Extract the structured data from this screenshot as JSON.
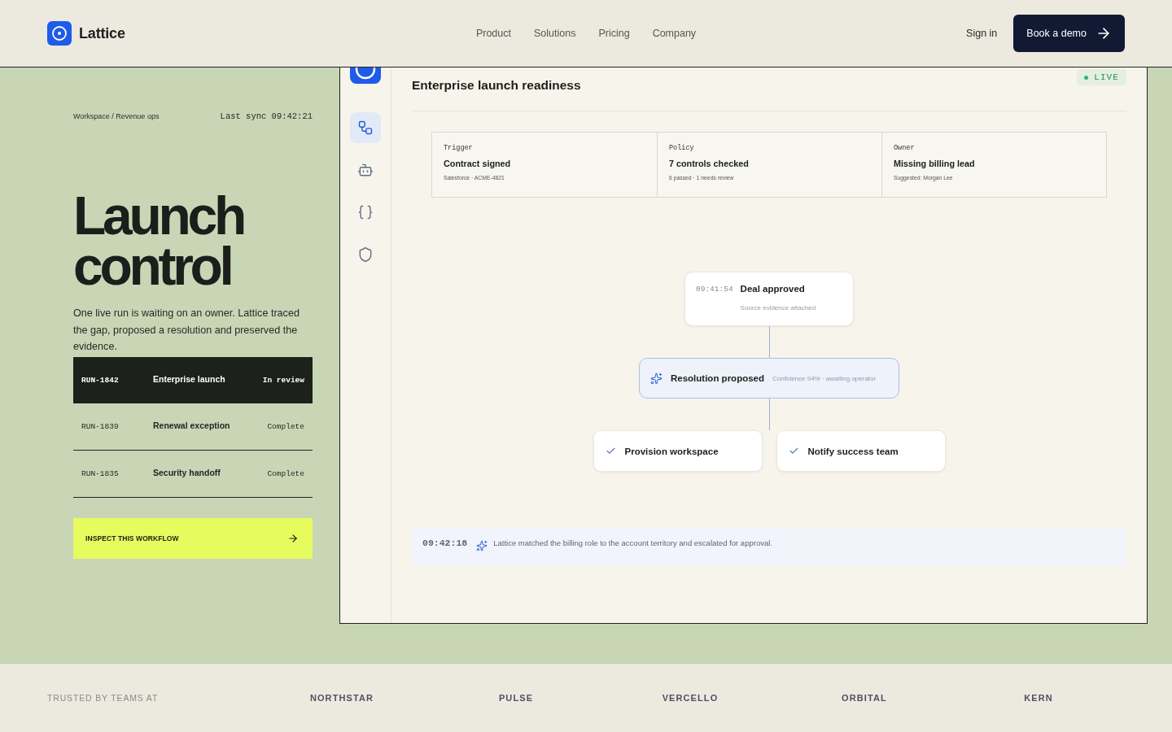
{
  "header": {
    "brand": "Lattice",
    "nav": [
      "Product",
      "Solutions",
      "Pricing",
      "Company"
    ],
    "sign_in": "Sign in",
    "cta": "Book a demo"
  },
  "hero": {
    "breadcrumb": "Workspace / Revenue ops",
    "last_sync": "Last sync 09:42:21",
    "title": "Launch control",
    "description": "One live run is waiting on an owner. Lattice traced the gap, proposed a resolution and preserved the evidence.",
    "runs": [
      {
        "id": "RUN-1842",
        "name": "Enterprise launch",
        "status": "In review",
        "selected": true
      },
      {
        "id": "RUN-1839",
        "name": "Renewal exception",
        "status": "Complete",
        "selected": false
      },
      {
        "id": "RUN-1835",
        "name": "Security handoff",
        "status": "Complete",
        "selected": false
      }
    ],
    "cta": "INSPECT THIS WORKFLOW"
  },
  "app": {
    "sidebar": {
      "items": [
        {
          "selected": true
        },
        {
          "selected": false
        },
        {
          "selected": false
        },
        {
          "selected": false
        }
      ]
    },
    "title": "Enterprise launch readiness",
    "status": "LIVE",
    "summary": [
      {
        "label": "Trigger",
        "value": "Contract signed",
        "detail": "Salesforce · ACME-4821"
      },
      {
        "label": "Policy",
        "value": "7 controls checked",
        "detail": "6 passed · 1 needs review"
      },
      {
        "label": "Owner",
        "value": "Missing billing lead",
        "detail": "Suggested: Morgan Lee"
      }
    ],
    "flow": {
      "source": {
        "time": "09:41:54",
        "title": "Deal approved",
        "detail": "Source evidence attached"
      },
      "proposal": {
        "title": "Resolution proposed",
        "detail": "Confidence 94% · awaiting operator"
      },
      "actions": [
        {
          "label": "Provision workspace",
          "checked": true
        },
        {
          "label": "Notify success team",
          "checked": true
        }
      ]
    },
    "log": {
      "time": "09:42:18",
      "message": "Lattice matched the billing role to the account territory and escalated for approval."
    }
  },
  "footer": {
    "label": "TRUSTED BY TEAMS AT",
    "brands": [
      "NORTHSTAR",
      "PULSE",
      "VERCELLO",
      "ORBITAL",
      "KERN"
    ]
  }
}
